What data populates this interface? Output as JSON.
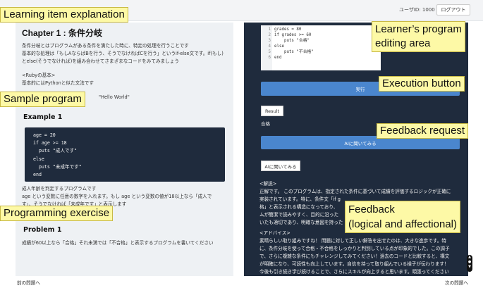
{
  "topbar": {
    "user_id": "ユーザID: 1000",
    "logout": "ログアウト"
  },
  "lesson": {
    "chapter_title": "Chapter 1 : 条件分岐",
    "intro": [
      "条件分岐とはプログラムがある条件を満たした時に、特定の処理を行うことです",
      "基本的な処理は「もしAならばBを行う、そうでなければCを行う」というif-else文です。if(もし)",
      "とelse(そうでなければ)を組み合わせてさまざまなコードをみてみましょう"
    ],
    "basic_heading": "<Rubyの基本>",
    "basic_text": "基本的にはPythonと似た文法です",
    "hello_text": "\"Hello World\"",
    "example_heading": "Example 1",
    "example_code": [
      "age = 20",
      "if age >= 18",
      "  puts \"成人です\"",
      "else",
      "  puts \"未成年です\"",
      "end"
    ],
    "example_desc": [
      "成人年齢を判定するプログラムです",
      "age という変数に任意の数字を入れます。もし age という変数の値が18以上なら「成人で",
      "す」、そうでなければ「未成年です」と表示します"
    ],
    "problem_heading": "Problem 1",
    "problem_text": "成績が60以上なら「合格」それ未満では「不合格」と表示するプログラムを書いてください"
  },
  "editor": {
    "lines": [
      {
        "n": "1",
        "code": "grades = 80"
      },
      {
        "n": "2",
        "code": "if grades >= 60"
      },
      {
        "n": "3",
        "code": "    puts \"合格\""
      },
      {
        "n": "4",
        "code": "else"
      },
      {
        "n": "5",
        "code": "    puts \"不合格\""
      },
      {
        "n": "6",
        "code": "end"
      }
    ]
  },
  "run_button": "実行",
  "result": {
    "tab": "Result",
    "value": "合格"
  },
  "ai": {
    "ask_button": "AIに聞いてみる",
    "tab": "AIに聞いてみる"
  },
  "feedback": {
    "lines": [
      "<解説>",
      "正解です。 このプログラムは、指定された条件に基づいて成績を評価するロジックが正確に",
      "実装されています。特に、条件文「if g",
      "格」と表示される構造になっており、",
      "ムが簡潔で読みやすく、目的に沿った",
      "いたも適切であり、明確な意図を持った",
      "<アドバイス>",
      "素晴らしい取り組みですね！ 問題に対して正しい解答を出せたのは、大きな進歩です。特",
      "に、条件分岐を使って合格・不合格をしっかりと判別している点が印象的でした。この調子",
      "で、さらに複雑な条件にもチャレンジしてみてください！過去のコードと比較すると、構文",
      "が明確になり、可読性も向上しています。自信を持って取り組んでいる様子が伝わります！",
      "今後も引き続き学び続けることで、さらにスキルが向上すると思います。頑張ってください"
    ]
  },
  "nav": {
    "prev": "前の問題へ",
    "next": "次の問題へ"
  },
  "annotations": {
    "learning_item": "Learning item explanation",
    "sample_program": "Sample program",
    "programming_exercise": "Programming exercise",
    "editing_area": [
      "Learner’s program",
      "editing area"
    ],
    "execution_button": "Execution button",
    "feedback_request": "Feedback request",
    "feedback": [
      "Feedback",
      "(logical and affectional)"
    ]
  }
}
